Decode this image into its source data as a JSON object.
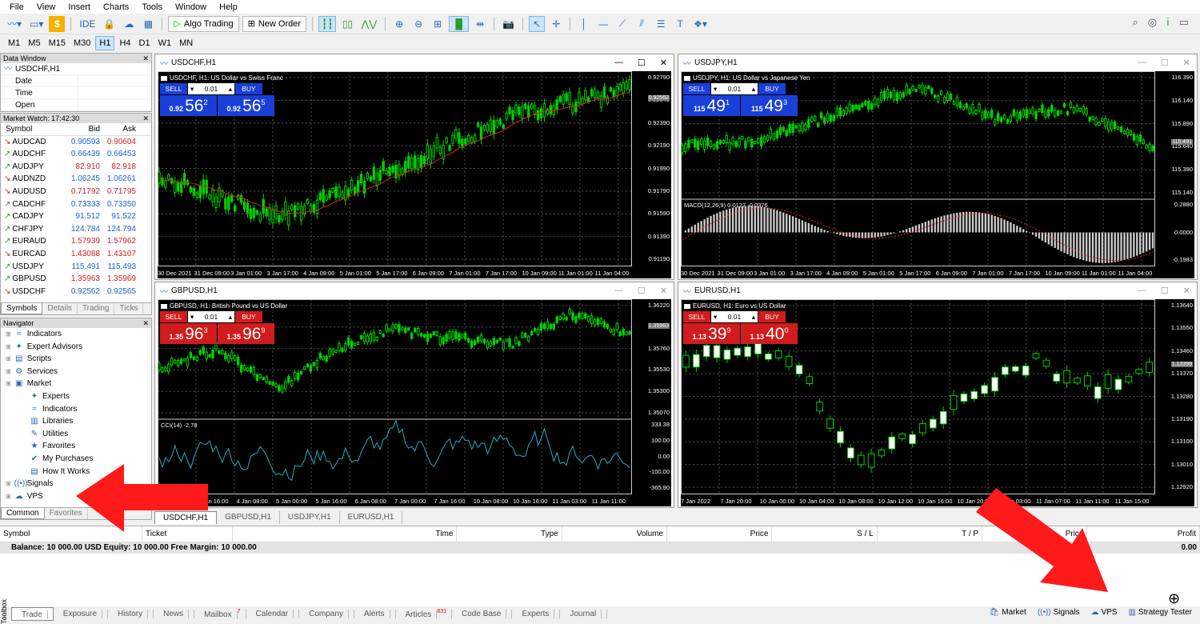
{
  "menu": [
    "File",
    "View",
    "Insert",
    "Charts",
    "Tools",
    "Window",
    "Help"
  ],
  "toolbar": {
    "ide": "IDE",
    "algo": "Algo Trading",
    "neworder": "New Order"
  },
  "timeframes": [
    "M1",
    "M5",
    "M15",
    "M30",
    "H1",
    "H4",
    "D1",
    "W1",
    "MN"
  ],
  "timeframe_selected": "H1",
  "data_window": {
    "title": "Data Window",
    "symbol": "USDCHF,H1",
    "rows": [
      "Date",
      "Time",
      "Open"
    ]
  },
  "market_watch": {
    "title": "Market Watch: 17:42:30",
    "headers": [
      "Symbol",
      "Bid",
      "Ask"
    ],
    "rows": [
      {
        "s": "AUDCAD",
        "bid": "0.90593",
        "ask": "0.90604",
        "bc": "up",
        "ac": "dn",
        "dir": "dn"
      },
      {
        "s": "AUDCHF",
        "bid": "0.66439",
        "ask": "0.66453",
        "bc": "up",
        "ac": "up",
        "dir": "up"
      },
      {
        "s": "AUDJPY",
        "bid": "82.910",
        "ask": "82.918",
        "bc": "dn",
        "ac": "dn",
        "dir": "up"
      },
      {
        "s": "AUDNZD",
        "bid": "1.06245",
        "ask": "1.06261",
        "bc": "up",
        "ac": "up",
        "dir": "dn"
      },
      {
        "s": "AUDUSD",
        "bid": "0.71792",
        "ask": "0.71795",
        "bc": "dn",
        "ac": "dn",
        "dir": "dn"
      },
      {
        "s": "CADCHF",
        "bid": "0.73333",
        "ask": "0.73350",
        "bc": "up",
        "ac": "up",
        "dir": "up"
      },
      {
        "s": "CADJPY",
        "bid": "91.512",
        "ask": "91.522",
        "bc": "up",
        "ac": "up",
        "dir": "up"
      },
      {
        "s": "CHFJPY",
        "bid": "124.784",
        "ask": "124.794",
        "bc": "up",
        "ac": "up",
        "dir": "up"
      },
      {
        "s": "EURAUD",
        "bid": "1.57939",
        "ask": "1.57962",
        "bc": "dn",
        "ac": "dn",
        "dir": "up"
      },
      {
        "s": "EURCAD",
        "bid": "1.43088",
        "ask": "1.43107",
        "bc": "dn",
        "ac": "dn",
        "dir": "dn"
      },
      {
        "s": "USDJPY",
        "bid": "115.491",
        "ask": "115.493",
        "bc": "up",
        "ac": "up",
        "dir": "up"
      },
      {
        "s": "GBPUSD",
        "bid": "1.35963",
        "ask": "1.35969",
        "bc": "dn",
        "ac": "dn",
        "dir": "up"
      },
      {
        "s": "USDCHF",
        "bid": "0.92562",
        "ask": "0.92565",
        "bc": "up",
        "ac": "up",
        "dir": "dn"
      }
    ],
    "tabs": [
      "Symbols",
      "Details",
      "Trading",
      "Ticks"
    ]
  },
  "navigator": {
    "title": "Navigator",
    "items": [
      {
        "l": "Indicators",
        "lvl": 0,
        "ico": "≈"
      },
      {
        "l": "Expert Advisors",
        "lvl": 0,
        "ico": "✦"
      },
      {
        "l": "Scripts",
        "lvl": 0,
        "ico": "▤"
      },
      {
        "l": "Services",
        "lvl": 0,
        "ico": "⚙"
      },
      {
        "l": "Market",
        "lvl": 0,
        "ico": "▣"
      },
      {
        "l": "Experts",
        "lvl": 1,
        "ico": "✦"
      },
      {
        "l": "Indicators",
        "lvl": 1,
        "ico": "≈"
      },
      {
        "l": "Libraries",
        "lvl": 1,
        "ico": "▥"
      },
      {
        "l": "Utilities",
        "lvl": 1,
        "ico": "✎"
      },
      {
        "l": "Favorites",
        "lvl": 1,
        "ico": "★"
      },
      {
        "l": "My Purchases",
        "lvl": 1,
        "ico": "✔"
      },
      {
        "l": "How It Works",
        "lvl": 1,
        "ico": "▤"
      },
      {
        "l": "Signals",
        "lvl": 0,
        "ico": "((•))"
      },
      {
        "l": "VPS",
        "lvl": 0,
        "ico": "☁"
      }
    ],
    "tabs": [
      "Common",
      "Favorites"
    ]
  },
  "charts": [
    {
      "id": "usdchf",
      "title": "USDCHF,H1",
      "desc": "USDCHF, H1: US Dollar vs Swiss Franc",
      "color": "blue",
      "sell_big": "56",
      "sell_sup": "2",
      "buy_big": "56",
      "buy_sup": "5",
      "small": "0.92",
      "small_b": "0.92",
      "lot": "0.01",
      "price_tag": "0.92562",
      "y": [
        "0.92790",
        "0.92540",
        "0.92390",
        "0.92190",
        "0.91990",
        "0.91790",
        "0.91590",
        "0.91390",
        "0.91190"
      ],
      "x": [
        "30 Dec 2021",
        "31 Dec 09:00",
        "3 Jan 01:00",
        "3 Jan 17:00",
        "4 Jan 09:00",
        "5 Jan 01:00",
        "5 Jan 17:00",
        "6 Jan 09:00",
        "7 Jan 01:00",
        "7 Jan 17:00",
        "10 Jan 09:00",
        "11 Jan 01:00",
        "11 Jan 04:00"
      ]
    },
    {
      "id": "usdjpy",
      "title": "USDJPY,H1",
      "desc": "USDJPY, H1: US Dollar vs Japanese Yen",
      "color": "blue",
      "sell_big": "49",
      "sell_sup": "1",
      "buy_big": "49",
      "buy_sup": "3",
      "small": "115",
      "small_b": "115",
      "lot": "0.01",
      "price_tag": "115.491",
      "y": [
        "116.390",
        "116.140",
        "115.890",
        "115.640",
        "115.390",
        "115.140"
      ],
      "ind": "MACD(12,26,9) 0.0127 -0.0376",
      "indy": [
        "0.2880",
        "0.0000",
        "-0.1983"
      ],
      "x": [
        "30 Dec 2021",
        "31 Dec 09:00",
        "3 Jan 01:00",
        "3 Jan 17:00",
        "4 Jan 09:00",
        "5 Jan 01:00",
        "5 Jan 17:00",
        "6 Jan 09:00",
        "7 Jan 01:00",
        "7 Jan 17:00",
        "10 Jan 09:00",
        "11 Jan 01:00",
        "11 Jan 04:00"
      ]
    },
    {
      "id": "gbpusd",
      "title": "GBPUSD,H1",
      "desc": "GBPUSD, H1: British Pound vs US Dollar",
      "color": "red",
      "sell_big": "96",
      "sell_sup": "3",
      "buy_big": "96",
      "buy_sup": "9",
      "small": "1.35",
      "small_b": "1.35",
      "lot": "0.01",
      "price_tag": "1.35963",
      "y": [
        "1.36220",
        "1.35960",
        "1.35760",
        "1.35530",
        "1.35300",
        "1.35070"
      ],
      "ind": "CCI(14) -2.78",
      "indy": [
        "333.38",
        "100.00",
        "0.00",
        "-100.00",
        "-365.90"
      ],
      "x": [
        "3 Jan 2022",
        "3 Jan 16:00",
        "4 Jan 08:00",
        "5 Jan 00:00",
        "5 Jan 16:00",
        "6 Jan 08:00",
        "7 Jan 00:00",
        "7 Jan 16:00",
        "10 Jan 08:00",
        "10 Jan 16:00",
        "11 Jan 03:00",
        "11 Jan 11:00"
      ]
    },
    {
      "id": "eurusd",
      "title": "EURUSD,H1",
      "desc": "EURUSD, H1: Euro vs US Dollar",
      "color": "red",
      "sell_big": "39",
      "sell_sup": "9",
      "buy_big": "40",
      "buy_sup": "0",
      "small": "1.13",
      "small_b": "1.13",
      "lot": "0.01",
      "price_tag": "1.13399",
      "y": [
        "1.13640",
        "1.13550",
        "1.13460",
        "1.13370",
        "1.13280",
        "1.13190",
        "1.13100",
        "1.13010",
        "1.12920"
      ],
      "x": [
        "7 Jan 2022",
        "7 Jan 20:00",
        "10 Jan 00:00",
        "10 Jan 04:00",
        "10 Jan 08:00",
        "10 Jan 12:00",
        "10 Jan 16:00",
        "10 Jan 20:00",
        "11 Jan 03:00",
        "11 Jan 07:00",
        "11 Jan 11:00",
        "11 Jan 15:00"
      ]
    }
  ],
  "chart_tabs": [
    "USDCHF,H1",
    "GBPUSD,H1",
    "USDJPY,H1",
    "EURUSD,H1"
  ],
  "terminal": {
    "headers": [
      "Symbol",
      "Ticket",
      "Time",
      "Type",
      "Volume",
      "Price",
      "S / L",
      "T / P",
      "Price",
      "Profit"
    ],
    "balance": "Balance: 10 000.00 USD  Equity: 10 000.00  Free Margin: 10 000.00",
    "profit": "0.00"
  },
  "bottom_tabs": [
    {
      "l": "Trade"
    },
    {
      "l": "Exposure"
    },
    {
      "l": "History"
    },
    {
      "l": "News"
    },
    {
      "l": "Mailbox",
      "b": "7"
    },
    {
      "l": "Calendar"
    },
    {
      "l": "Company"
    },
    {
      "l": "Alerts"
    },
    {
      "l": "Articles",
      "b": "831"
    },
    {
      "l": "Code Base"
    },
    {
      "l": "Experts"
    },
    {
      "l": "Journal"
    }
  ],
  "status_right": [
    "Market",
    "Signals",
    "VPS",
    "Strategy Tester"
  ],
  "toolbox": "Toolbox",
  "labels": {
    "sell": "SELL",
    "buy": "BUY"
  }
}
